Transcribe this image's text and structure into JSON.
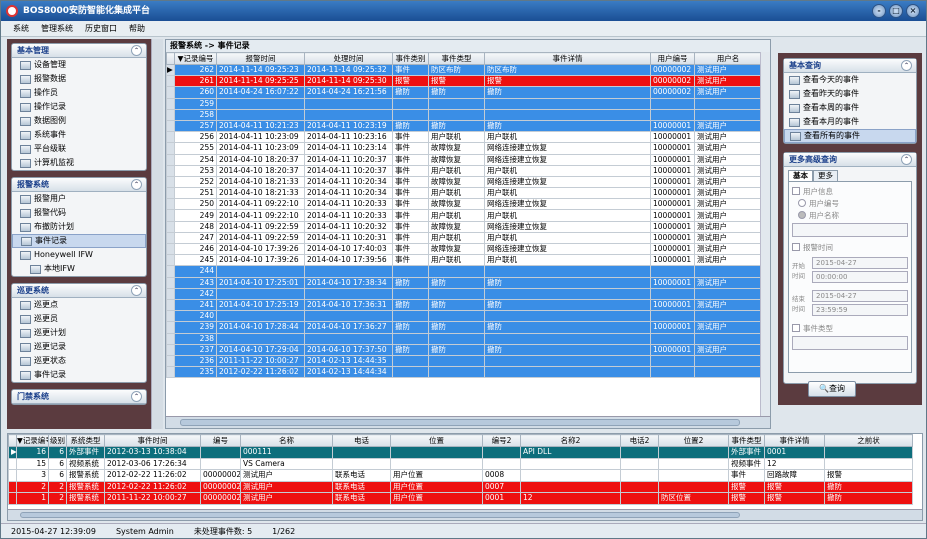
{
  "window": {
    "title": "BOS8000安防智能化集成平台",
    "btn_min": "-",
    "btn_max": "□",
    "btn_close": "×"
  },
  "menu": [
    "系统",
    "管理系统",
    "历史窗口",
    "帮助"
  ],
  "left": {
    "groups": [
      {
        "title": "基本管理",
        "items": [
          "设备管理",
          "报警数据",
          "操作员",
          "操作记录",
          "数据图例",
          "系统事件",
          "平台级联",
          "计算机监视"
        ]
      },
      {
        "title": "报警系统",
        "items": [
          "报警用户",
          "报警代码",
          "布撤防计划",
          "事件记录",
          "Honeywell IFW"
        ],
        "sub": "本地IFW",
        "selected": 3
      },
      {
        "title": "巡更系统",
        "items": [
          "巡更点",
          "巡更员",
          "巡更计划",
          "巡更记录",
          "巡更状态",
          "事件记录"
        ]
      },
      {
        "title": "门禁系统",
        "items": []
      }
    ]
  },
  "main": {
    "breadcrumb": "报警系统 -> 事件记录",
    "columns": [
      "▼记录编号",
      "报警时间",
      "处理时间",
      "事件类别",
      "事件类型",
      "事件详情",
      "用户编号",
      "用户名"
    ],
    "rows": [
      {
        "c": "blue",
        "v": [
          "262",
          "2014-11-14 09:25:23",
          "2014-11-14 09:25:32",
          "事件",
          "防区布防",
          "防区布防",
          "00000002",
          "测试用户"
        ]
      },
      {
        "c": "red",
        "v": [
          "261",
          "2014-11-14 09:25:25",
          "2014-11-14 09:25:30",
          "报警",
          "报警",
          "报警",
          "00000002",
          "测试用户"
        ]
      },
      {
        "c": "blue",
        "v": [
          "260",
          "2014-04-24 16:07:22",
          "2014-04-24 16:21:56",
          "撤防",
          "撤防",
          "撤防",
          "00000002",
          "测试用户"
        ]
      },
      {
        "c": "blue",
        "v": [
          "259",
          "",
          "",
          "",
          "",
          "",
          "",
          ""
        ]
      },
      {
        "c": "blue",
        "v": [
          "258",
          "",
          "",
          "",
          "",
          "",
          "",
          ""
        ]
      },
      {
        "c": "blue",
        "v": [
          "257",
          "2014-04-11 10:21:23",
          "2014-04-11 10:23:19",
          "撤防",
          "撤防",
          "撤防",
          "10000001",
          "测试用户"
        ]
      },
      {
        "c": "white",
        "v": [
          "256",
          "2014-04-11 10:23:09",
          "2014-04-11 10:23:16",
          "事件",
          "用户联机",
          "用户联机",
          "10000001",
          "测试用户"
        ]
      },
      {
        "c": "white",
        "v": [
          "255",
          "2014-04-11 10:23:09",
          "2014-04-11 10:23:14",
          "事件",
          "故障恢复",
          "网络连接建立恢复",
          "10000001",
          "测试用户"
        ]
      },
      {
        "c": "white",
        "v": [
          "254",
          "2014-04-10 18:20:37",
          "2014-04-11 10:20:37",
          "事件",
          "故障恢复",
          "网络连接建立恢复",
          "10000001",
          "测试用户"
        ]
      },
      {
        "c": "white",
        "v": [
          "253",
          "2014-04-10 18:20:37",
          "2014-04-11 10:20:37",
          "事件",
          "用户联机",
          "用户联机",
          "10000001",
          "测试用户"
        ]
      },
      {
        "c": "white",
        "v": [
          "252",
          "2014-04-10 18:21:33",
          "2014-04-11 10:20:34",
          "事件",
          "故障恢复",
          "网络连接建立恢复",
          "10000001",
          "测试用户"
        ]
      },
      {
        "c": "white",
        "v": [
          "251",
          "2014-04-10 18:21:33",
          "2014-04-11 10:20:34",
          "事件",
          "用户联机",
          "用户联机",
          "10000001",
          "测试用户"
        ]
      },
      {
        "c": "white",
        "v": [
          "250",
          "2014-04-11 09:22:10",
          "2014-04-11 10:20:33",
          "事件",
          "故障恢复",
          "网络连接建立恢复",
          "10000001",
          "测试用户"
        ]
      },
      {
        "c": "white",
        "v": [
          "249",
          "2014-04-11 09:22:10",
          "2014-04-11 10:20:33",
          "事件",
          "用户联机",
          "用户联机",
          "10000001",
          "测试用户"
        ]
      },
      {
        "c": "white",
        "v": [
          "248",
          "2014-04-11 09:22:59",
          "2014-04-11 10:20:32",
          "事件",
          "故障恢复",
          "网络连接建立恢复",
          "10000001",
          "测试用户"
        ]
      },
      {
        "c": "white",
        "v": [
          "247",
          "2014-04-11 09:22:59",
          "2014-04-11 10:20:31",
          "事件",
          "用户联机",
          "用户联机",
          "10000001",
          "测试用户"
        ]
      },
      {
        "c": "white",
        "v": [
          "246",
          "2014-04-10 17:39:26",
          "2014-04-10 17:40:03",
          "事件",
          "故障恢复",
          "网络连接建立恢复",
          "10000001",
          "测试用户"
        ]
      },
      {
        "c": "white",
        "v": [
          "245",
          "2014-04-10 17:39:26",
          "2014-04-10 17:39:56",
          "事件",
          "用户联机",
          "用户联机",
          "10000001",
          "测试用户"
        ]
      },
      {
        "c": "blue",
        "v": [
          "244",
          "",
          "",
          "",
          "",
          "",
          "",
          ""
        ]
      },
      {
        "c": "blue",
        "v": [
          "243",
          "2014-04-10 17:25:01",
          "2014-04-10 17:38:34",
          "撤防",
          "撤防",
          "撤防",
          "10000001",
          "测试用户"
        ]
      },
      {
        "c": "blue",
        "v": [
          "242",
          "",
          "",
          "",
          "",
          "",
          "",
          ""
        ]
      },
      {
        "c": "blue",
        "v": [
          "241",
          "2014-04-10 17:25:19",
          "2014-04-10 17:36:31",
          "撤防",
          "撤防",
          "撤防",
          "10000001",
          "测试用户"
        ]
      },
      {
        "c": "blue",
        "v": [
          "240",
          "",
          "",
          "",
          "",
          "",
          "",
          ""
        ]
      },
      {
        "c": "blue",
        "v": [
          "239",
          "2014-04-10 17:28:44",
          "2014-04-10 17:36:27",
          "撤防",
          "撤防",
          "撤防",
          "10000001",
          "测试用户"
        ]
      },
      {
        "c": "blue",
        "v": [
          "238",
          "",
          "",
          "",
          "",
          "",
          "",
          ""
        ]
      },
      {
        "c": "blue",
        "v": [
          "237",
          "2014-04-10 17:29:04",
          "2014-04-10 17:37:50",
          "撤防",
          "撤防",
          "撤防",
          "10000001",
          "测试用户"
        ]
      },
      {
        "c": "blue",
        "v": [
          "236",
          "2011-11-22 10:00:27",
          "2014-02-13 14:44:35",
          "",
          "",
          "",
          "",
          ""
        ]
      },
      {
        "c": "blue",
        "v": [
          "235",
          "2012-02-22 11:26:02",
          "2014-02-13 14:44:34",
          "",
          "",
          "",
          "",
          ""
        ]
      }
    ]
  },
  "right": {
    "basic_title": "基本查询",
    "basic_items": [
      "查看今天的事件",
      "查看昨天的事件",
      "查看本周的事件",
      "查看本月的事件",
      "查看所有的事件"
    ],
    "adv_title": "更多高级查询",
    "tabs": [
      "基本",
      "更多"
    ],
    "adv": {
      "user_info": "用户信息",
      "user_no": "用户编号",
      "user_name": "用户名称",
      "alarm_time": "报警时间",
      "start_label": "开始时间",
      "end_label": "结束时间",
      "start_date": "2015-04-27",
      "start_time": "00:00:00",
      "end_date": "2015-04-27",
      "end_time": "23:59:59",
      "event_type": "事件类型"
    },
    "query_btn": "查询"
  },
  "bottom": {
    "columns": [
      "▼记录编号",
      "级别",
      "系统类型",
      "事件时间",
      "编号",
      "名称",
      "电话",
      "位置",
      "编号2",
      "名称2",
      "电话2",
      "位置2",
      "事件类型",
      "事件详情",
      "之前状"
    ],
    "rows": [
      {
        "c": "teal",
        "v": [
          "16",
          "6",
          "外部事件",
          "2012-03-13 10:38:04",
          "",
          "000111",
          "",
          "",
          "",
          "API DLL",
          "",
          "",
          "外部事件",
          "0001",
          ""
        ]
      },
      {
        "c": "white",
        "v": [
          "15",
          "6",
          "视频系统",
          "2012-03-06 17:26:34",
          "",
          "VS Camera",
          "",
          "",
          "",
          "",
          "",
          "",
          "视频事件",
          "12",
          ""
        ]
      },
      {
        "c": "white",
        "v": [
          "3",
          "6",
          "报警系统",
          "2012-02-22 11:26:02",
          "00000002",
          "测试用户",
          "联系电话",
          "用户位置",
          "0008",
          "",
          "",
          "",
          "事件",
          "回路故障",
          "报警"
        ]
      },
      {
        "c": "red",
        "v": [
          "2",
          "2",
          "报警系统",
          "2012-02-22 11:26:02",
          "00000002",
          "测试用户",
          "联系电话",
          "用户位置",
          "0007",
          "",
          "",
          "",
          "报警",
          "报警",
          "撤防"
        ]
      },
      {
        "c": "red",
        "v": [
          "1",
          "2",
          "报警系统",
          "2011-11-22 10:00:27",
          "00000002",
          "测试用户",
          "联系电话",
          "用户位置",
          "0001",
          "12",
          "",
          "防区位置",
          "报警",
          "报警",
          "撤防"
        ]
      }
    ]
  },
  "status": {
    "time": "2015-04-27 12:39:09",
    "user": "System Admin",
    "pending": "未处理事件数: 5",
    "page": "1/262"
  }
}
